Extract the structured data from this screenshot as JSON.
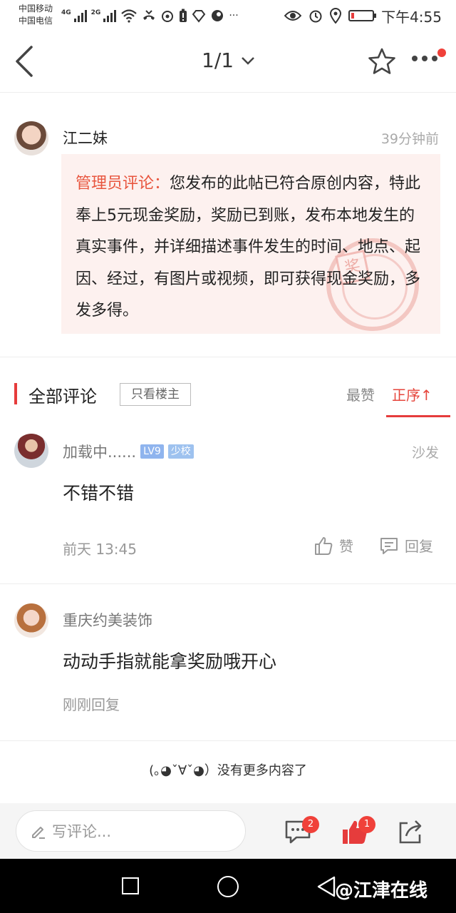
{
  "status_bar": {
    "carrier_1": "中国移动",
    "carrier_2": "中国电信",
    "net_1": "4G",
    "net_2": "2G",
    "more": "···",
    "time": "下午4:55"
  },
  "nav": {
    "pager": "1/1"
  },
  "post": {
    "author": "江二妹",
    "time": "39分钟前",
    "admin_label": "管理员评论：",
    "admin_text": "您发布的此帖已符合原创内容，特此奉上5元现金奖励，奖励已到账，发布本地发生的真实事件，并详细描述事件发生的时间、地点、起因、经过，有图片或视频，即可获得现金奖励，多发多得。",
    "stamp_char": "奖"
  },
  "comments_header": {
    "title": "全部评论",
    "owner_only": "只看楼主",
    "sort_hot": "最赞",
    "sort_asc": "正序↑"
  },
  "comments": [
    {
      "name": "加载中......",
      "level": "LV9",
      "role": "少校",
      "floor": "沙发",
      "text": "不错不错",
      "time": "前天 13:45",
      "like": "赞",
      "reply": "回复"
    },
    {
      "name": "重庆约美装饰",
      "text": "动动手指就能拿奖励哦开心",
      "time": "刚刚回复"
    }
  ],
  "footer_note": "(｡◕ˇ∀ˇ◕）没有更多内容了",
  "toolbar": {
    "compose_placeholder": "写评论...",
    "comment_count": "2",
    "like_count": "1"
  },
  "watermark": "@江津在线",
  "colors": {
    "accent": "#e63c3c",
    "admin_label": "#e8553e",
    "admin_bg": "#fdf1ef",
    "badge_blue": "#8fb4ee"
  }
}
